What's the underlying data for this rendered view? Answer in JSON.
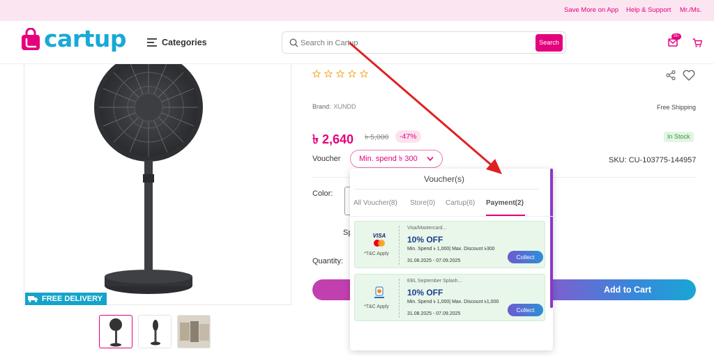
{
  "topbar": {
    "save_more": "Save More on App",
    "help": "Help & Support",
    "account": "Mr./Ms."
  },
  "header": {
    "logo_text": "cartup",
    "categories_label": "Categories",
    "search_placeholder": "Search in Cartup",
    "search_button": "Search",
    "mail_badge": "20+"
  },
  "product": {
    "free_delivery": "FREE DELIVERY",
    "brand_label": "Brand:",
    "brand_value": "XUNDD",
    "free_shipping": "Free Shipping",
    "price": "৳ 2,640",
    "old_price": "৳ 5,000",
    "discount": "-47%",
    "stock": "In Stock",
    "voucher_label": "Voucher",
    "voucher_dropdown": "Min. spend ৳ 300",
    "sku": "SKU: CU-103775-144957",
    "color_label": "Color:",
    "sp_fragment": "Sp",
    "quantity_label": "Quantity:",
    "add_to_cart": "Add to Cart",
    "rating_stars": 0
  },
  "voucher_popup": {
    "title": "Voucher(s)",
    "tabs": [
      {
        "label": "All Voucher(8)"
      },
      {
        "label": "Store(0)"
      },
      {
        "label": "Cartup(6)"
      },
      {
        "label": "Payment(2)"
      }
    ],
    "active_tab": "Payment(2)",
    "vouchers": [
      {
        "title": "Visa/Mastercard...",
        "offer": "10% OFF",
        "terms": "Min. Spend ৳ 1,000| Max. Discount ৳300",
        "dates": "31.08.2025 - 07.09.2025",
        "tnc": "*T&C Apply",
        "collect": "Collect",
        "logo_text": "VISA"
      },
      {
        "title": "EBL September Splash...",
        "offer": "10% OFF",
        "terms": "Min. Spend ৳ 1,000| Max. Discount ৳1,000",
        "dates": "31.08.2025 - 07.09.2025",
        "tnc": "*T&C Apply",
        "collect": "Collect"
      }
    ]
  },
  "colors": {
    "brand_pink": "#e5007d",
    "brand_blue": "#18a9d6",
    "annotation_red": "#e02020"
  }
}
